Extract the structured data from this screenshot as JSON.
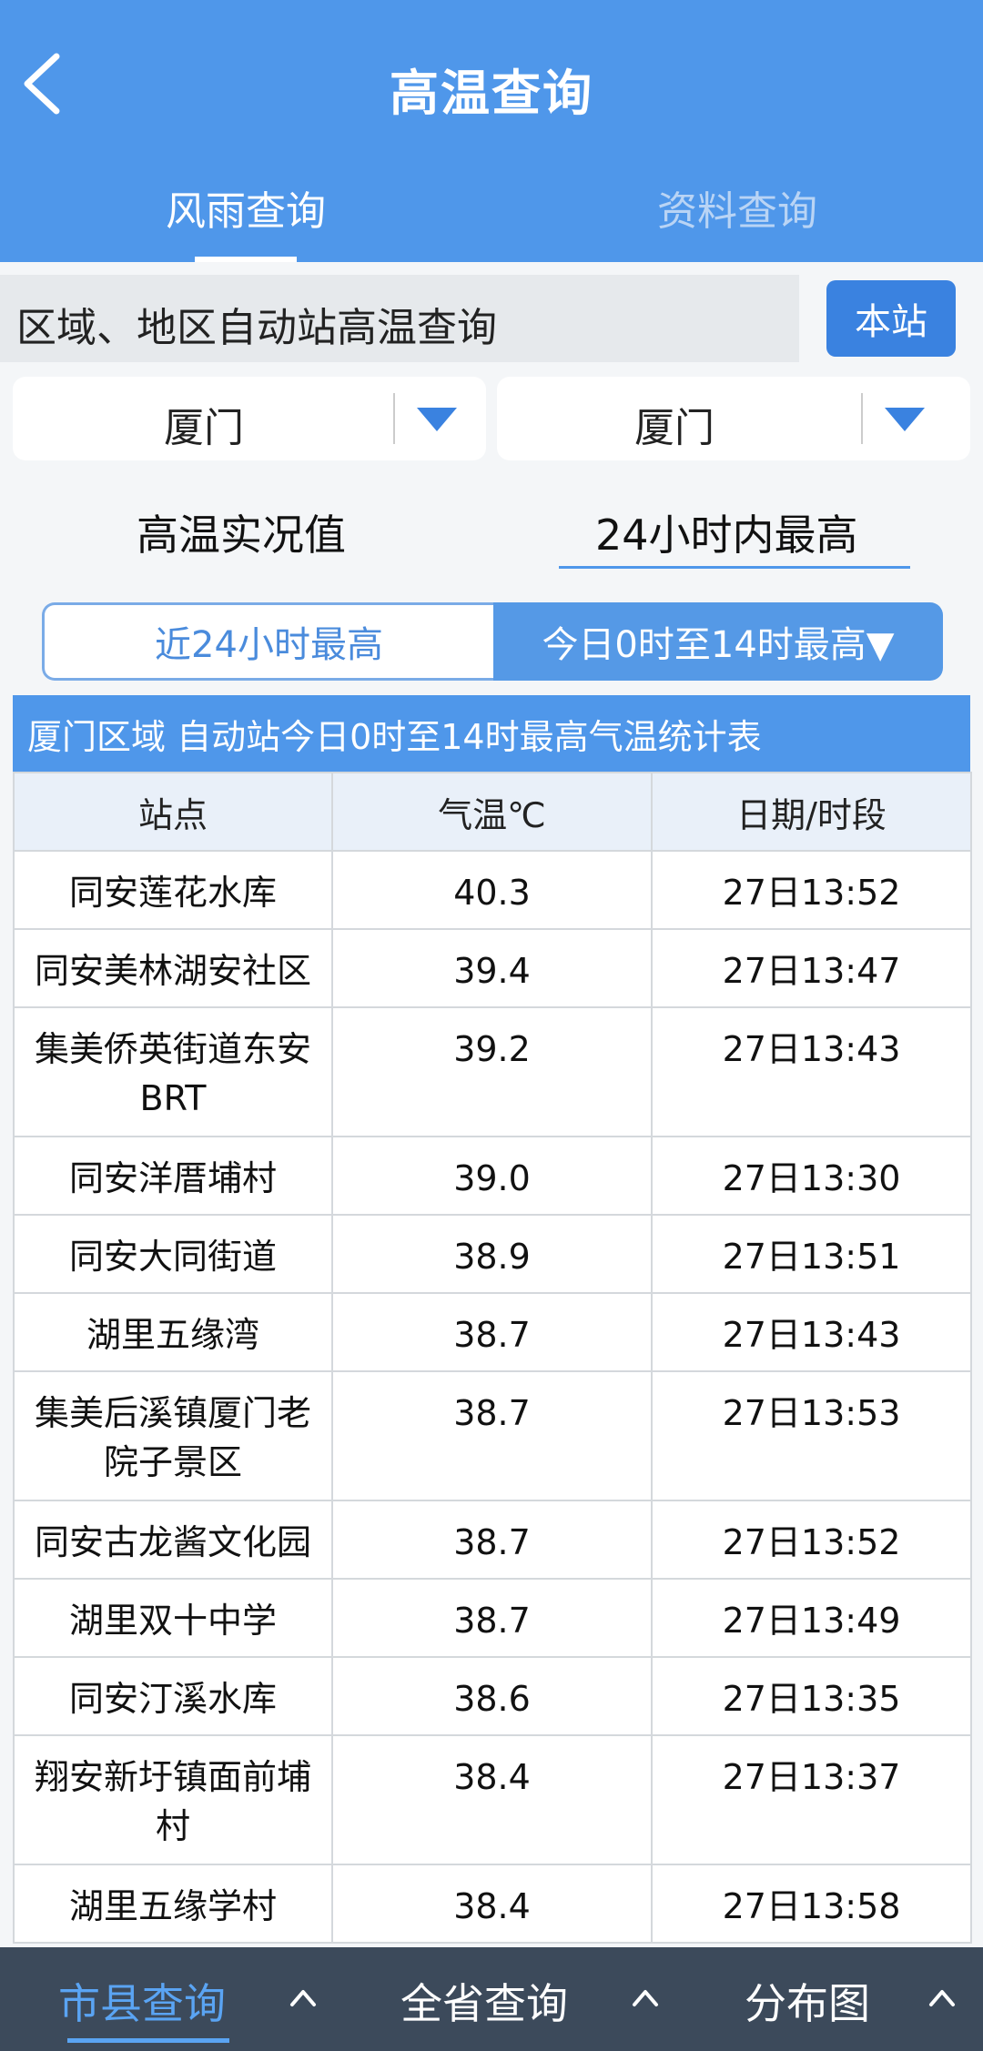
{
  "header": {
    "title": "高温查询",
    "tabs": [
      {
        "label": "风雨查询",
        "active": true
      },
      {
        "label": "资料查询",
        "active": false
      }
    ],
    "accent": "#4f97ea"
  },
  "query": {
    "label": "区域、地区自动站高温查询",
    "station_button": "本站"
  },
  "selects": [
    {
      "value": "厦门"
    },
    {
      "value": "厦门"
    }
  ],
  "sub_tabs": [
    {
      "label": "高温实况值",
      "active": false
    },
    {
      "label": "24小时内最高",
      "active": true
    }
  ],
  "segments": [
    {
      "label": "近24小时最高",
      "active": false
    },
    {
      "label": "今日0时至14时最高▼",
      "active": true
    }
  ],
  "table": {
    "title": "厦门区域 自动站今日0时至14时最高气温统计表",
    "headers": [
      "站点",
      "气温℃",
      "日期/时段"
    ],
    "rows": [
      {
        "station": "同安莲花水库",
        "temp": "40.3",
        "time": "27日13:52"
      },
      {
        "station": "同安美林湖安社区",
        "temp": "39.4",
        "time": "27日13:47"
      },
      {
        "station": "集美侨英街道东安BRT",
        "temp": "39.2",
        "time": "27日13:43"
      },
      {
        "station": "同安洋厝埔村",
        "temp": "39.0",
        "time": "27日13:30"
      },
      {
        "station": "同安大同街道",
        "temp": "38.9",
        "time": "27日13:51"
      },
      {
        "station": "湖里五缘湾",
        "temp": "38.7",
        "time": "27日13:43"
      },
      {
        "station": "集美后溪镇厦门老院子景区",
        "temp": "38.7",
        "time": "27日13:53"
      },
      {
        "station": "同安古龙酱文化园",
        "temp": "38.7",
        "time": "27日13:52"
      },
      {
        "station": "湖里双十中学",
        "temp": "38.7",
        "time": "27日13:49"
      },
      {
        "station": "同安汀溪水库",
        "temp": "38.6",
        "time": "27日13:35"
      },
      {
        "station": "翔安新圩镇面前埔村",
        "temp": "38.4",
        "time": "27日13:37"
      },
      {
        "station": "湖里五缘学村",
        "temp": "38.4",
        "time": "27日13:58"
      }
    ]
  },
  "bottom_nav": [
    {
      "label": "市县查询",
      "active": true
    },
    {
      "label": "全省查询",
      "active": false
    },
    {
      "label": "分布图",
      "active": false
    }
  ]
}
